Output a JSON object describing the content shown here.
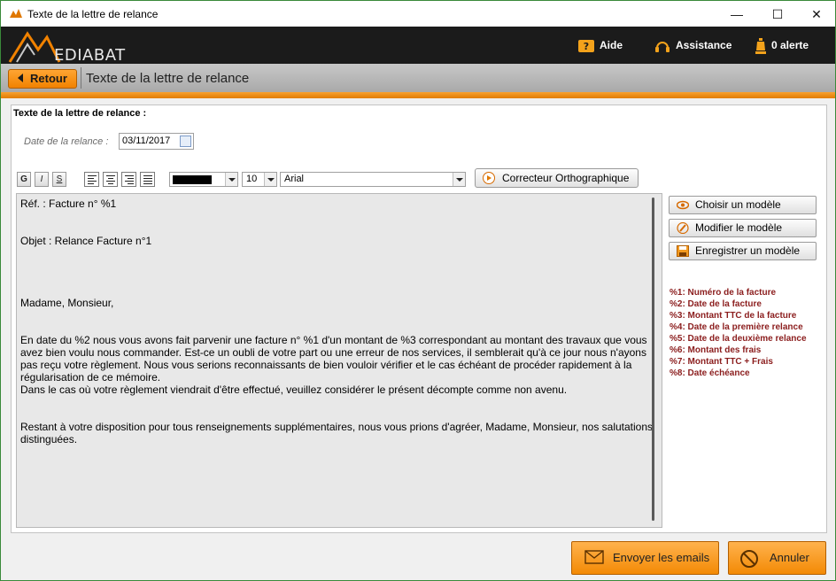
{
  "window": {
    "title": "Texte de la lettre de relance",
    "minimize": "—",
    "maximize": "☐",
    "close": "✕"
  },
  "header": {
    "logo_text": "EDIABAT",
    "help_label": "Aide",
    "assistance_label": "Assistance",
    "alert_label": "0 alerte"
  },
  "nav": {
    "back_label": "Retour",
    "page_title": "Texte de la lettre de relance"
  },
  "form": {
    "group_title": "Texte de la lettre de relance :",
    "date_label": "Date de la relance :",
    "date_value": "03/11/2017"
  },
  "toolbar": {
    "bold": "G",
    "italic": "I",
    "underline": "S",
    "color": "#000000",
    "font_size": "10",
    "font_name": "Arial",
    "spellcheck_label": "Correcteur Orthographique"
  },
  "letter": {
    "ref": "Réf. : Facture n° %1",
    "subject": "Objet : Relance Facture n°1",
    "greeting": "Madame, Monsieur,",
    "body1": "En date du %2 nous vous avons fait parvenir une facture n° %1 d'un montant de %3 correspondant au montant des travaux que vous avez bien voulu nous commander. Est-ce un oubli de votre part ou une erreur de nos services, il semblerait qu'à ce jour nous n'ayons pas reçu votre règlement. Nous vous serions reconnaissants de bien vouloir vérifier et le cas échéant de procéder rapidement à la régularisation de ce mémoire.",
    "body2": "Dans le cas où votre règlement viendrait d'être effectué, veuillez considérer le présent décompte comme non avenu.",
    "closing": "Restant à votre disposition pour tous renseignements supplémentaires, nous vous prions d'agréer, Madame, Monsieur, nos salutations distinguées."
  },
  "templates": {
    "choose_label": "Choisir un modèle",
    "edit_label": "Modifier le modèle",
    "save_label": "Enregistrer un modèle"
  },
  "legend": [
    "%1: Numéro de la facture",
    "%2: Date de la facture",
    "%3: Montant TTC de la facture",
    "%4: Date de la première relance",
    "%5: Date de la deuxième relance",
    "%6: Montant des frais",
    "%7: Montant TTC + Frais",
    "%8: Date échéance"
  ],
  "actions": {
    "send_label": "Envoyer les emails",
    "cancel_label": "Annuler"
  },
  "colors": {
    "accent": "#f18200",
    "legend_text": "#8b1d1d",
    "header_bg": "#1b1b1b"
  }
}
